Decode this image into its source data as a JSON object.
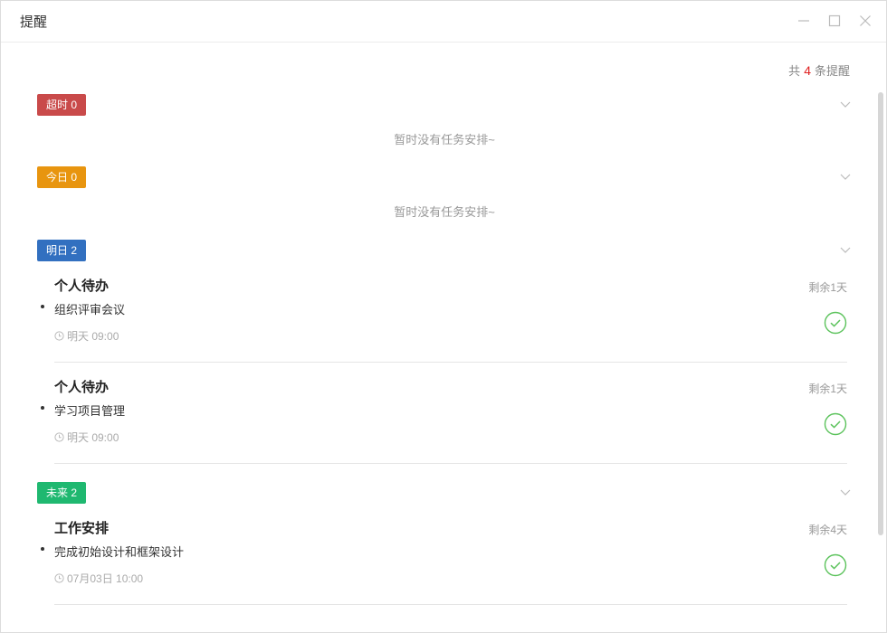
{
  "window": {
    "title": "提醒"
  },
  "summary": {
    "prefix": "共",
    "count": "4",
    "suffix": "条提醒"
  },
  "groups": [
    {
      "label": "超时 0",
      "color": "#c94a4a",
      "empty_text": "暂时没有任务安排~"
    },
    {
      "label": "今日 0",
      "color": "#e8950f",
      "empty_text": "暂时没有任务安排~"
    },
    {
      "label": "明日 2",
      "color": "#3270c0"
    },
    {
      "label": "未来 2",
      "color": "#1fb870"
    }
  ],
  "items": [
    {
      "category": "个人待办",
      "text": "组织评审会议",
      "time": "明天 09:00",
      "remaining": "剩余1天"
    },
    {
      "category": "个人待办",
      "text": "学习项目管理",
      "time": "明天 09:00",
      "remaining": "剩余1天"
    },
    {
      "category": "工作安排",
      "text": "完成初始设计和框架设计",
      "time": "07月03日 10:00",
      "remaining": "剩余4天"
    }
  ],
  "icons": {
    "minimize": "minimize-icon",
    "maximize": "maximize-icon",
    "close": "close-icon",
    "chevron": "chevron-down-icon",
    "clock": "clock-icon",
    "check": "check-circle-icon"
  },
  "colors": {
    "check": "#5cc35c",
    "count": "#e02020"
  }
}
